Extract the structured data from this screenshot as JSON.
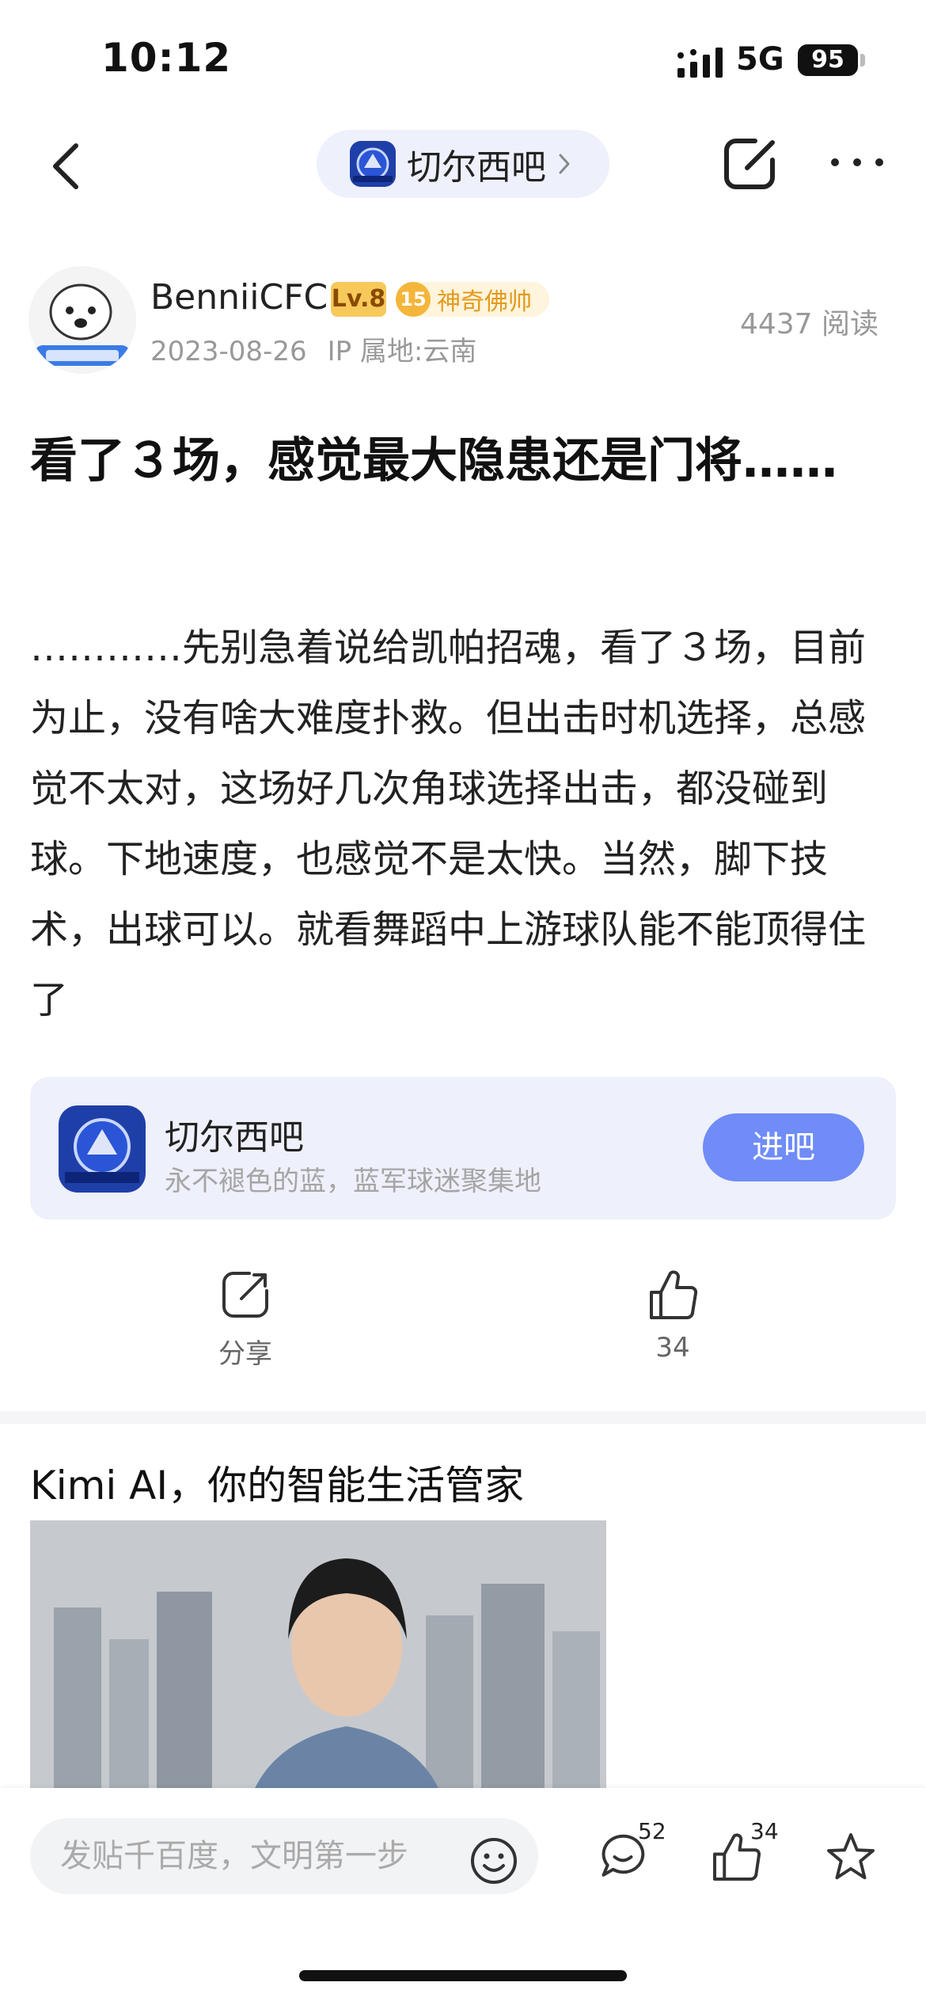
{
  "status_bar": {
    "time": "10:12",
    "network": "5G",
    "battery": "95"
  },
  "nav": {
    "forum_name": "切尔西吧"
  },
  "post": {
    "author": "BenniiCFC",
    "level": "Lv.8",
    "title_badge_level": "15",
    "title_badge_text": "神奇佛帅",
    "date": "2023-08-26",
    "ip_location": "IP 属地:云南",
    "read_count": "4437 阅读",
    "title": "看了３场，感觉最大隐患还是门将……",
    "content": "…………先别急着说给凯帕招魂，看了３场，目前为止，没有啥大难度扑救。但出击时机选择，总感觉不太对，这场好几次角球选择出击，都没碰到球。下地速度，也感觉不是太快。当然，脚下技术，出球可以。就看舞蹈中上游球队能不能顶得住了"
  },
  "forum_card": {
    "name": "切尔西吧",
    "description": "永不褪色的蓝，蓝军球迷聚集地",
    "join_label": "进吧"
  },
  "actions": {
    "share_label": "分享",
    "like_count": "34"
  },
  "ad": {
    "title": "Kimi AI，你的智能生活管家"
  },
  "bottom_bar": {
    "comment_placeholder": "发贴千百度，文明第一步",
    "comment_count": "52",
    "like_count": "34"
  },
  "icons": {
    "back": "chevron-left-icon",
    "edit": "edit-square-icon",
    "more": "more-dots-icon",
    "share": "share-icon",
    "like": "thumbs-up-icon",
    "comment": "comment-bubble-icon",
    "emoji": "smiley-icon",
    "favorite": "star-icon"
  },
  "colors": {
    "accent": "#6f8cf7",
    "pill_bg": "#eef0fb",
    "level_badge": "#f7c95b",
    "title_badge": "#f4b53a",
    "meta_text": "#999999"
  }
}
